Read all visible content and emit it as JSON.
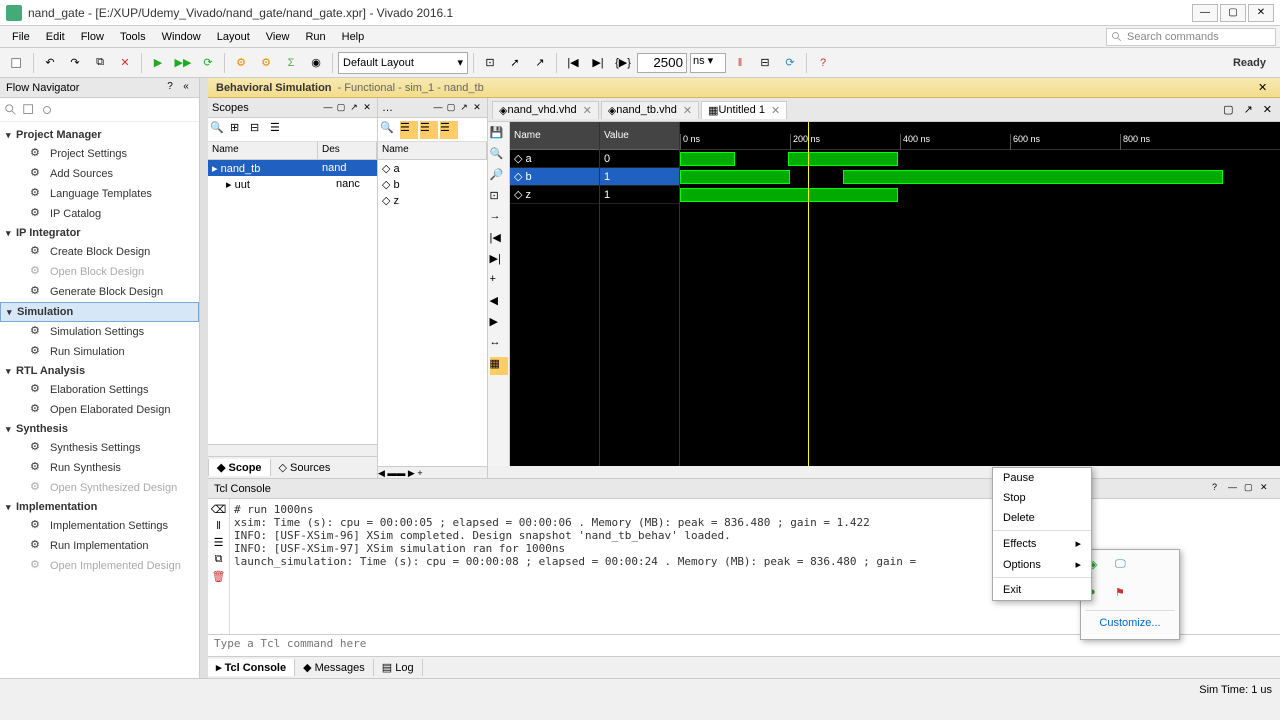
{
  "title": "nand_gate - [E:/XUP/Udemy_Vivado/nand_gate/nand_gate.xpr] - Vivado 2016.1",
  "menus": [
    "File",
    "Edit",
    "Flow",
    "Tools",
    "Window",
    "Layout",
    "View",
    "Run",
    "Help"
  ],
  "search_placeholder": "Search commands",
  "layout_combo": "Default Layout",
  "time_value": "2500",
  "time_unit": "ns",
  "ready": "Ready",
  "flownav": {
    "title": "Flow Navigator",
    "sections": [
      {
        "name": "Project Manager",
        "items": [
          "Project Settings",
          "Add Sources",
          "Language Templates",
          "IP Catalog"
        ]
      },
      {
        "name": "IP Integrator",
        "items": [
          "Create Block Design",
          "Open Block Design",
          "Generate Block Design"
        ]
      },
      {
        "name": "Simulation",
        "selected": true,
        "items": [
          "Simulation Settings",
          "Run Simulation"
        ]
      },
      {
        "name": "RTL Analysis",
        "items": [
          "Elaboration Settings",
          "Open Elaborated Design"
        ]
      },
      {
        "name": "Synthesis",
        "items": [
          "Synthesis Settings",
          "Run Synthesis",
          "Open Synthesized Design"
        ]
      },
      {
        "name": "Implementation",
        "items": [
          "Implementation Settings",
          "Run Implementation",
          "Open Implemented Design"
        ]
      }
    ]
  },
  "simheader": {
    "title": "Behavioral Simulation",
    "sub": "Functional",
    "run": "sim_1 - nand_tb"
  },
  "scopes": {
    "title": "Scopes",
    "cols": [
      "Name",
      "Des"
    ],
    "rows": [
      {
        "name": "nand_tb",
        "des": "nand",
        "selected": true
      },
      {
        "name": "uut",
        "des": "nanc",
        "indent": 1
      }
    ],
    "tabs": [
      "Scope",
      "Sources"
    ]
  },
  "objects": {
    "cols": [
      "Name"
    ],
    "rows": [
      {
        "name": "a"
      },
      {
        "name": "b"
      },
      {
        "name": "z"
      }
    ]
  },
  "wave": {
    "tabs": [
      {
        "label": "nand_vhd.vhd"
      },
      {
        "label": "nand_tb.vhd"
      },
      {
        "label": "Untitled 1",
        "active": true
      }
    ],
    "name_col": "Name",
    "value_col": "Value",
    "cursor": "235.501 ns",
    "ticks": [
      "0 ns",
      "200 ns",
      "400 ns",
      "600 ns",
      "800 ns"
    ],
    "signals": [
      {
        "name": "a",
        "value": "0"
      },
      {
        "name": "b",
        "value": "1",
        "selected": true
      },
      {
        "name": "z",
        "value": "1"
      }
    ]
  },
  "console": {
    "title": "Tcl Console",
    "lines": [
      "# run 1000ns",
      "xsim: Time (s): cpu = 00:00:05 ; elapsed = 00:00:06 . Memory (MB): peak = 836.480 ; gain = 1.422",
      "INFO: [USF-XSim-96] XSim completed. Design snapshot 'nand_tb_behav' loaded.",
      "INFO: [USF-XSim-97] XSim simulation ran for 1000ns",
      "launch_simulation: Time (s): cpu = 00:00:08 ; elapsed = 00:00:24 . Memory (MB): peak = 836.480 ; gain ="
    ],
    "placeholder": "Type a Tcl command here",
    "tabs": [
      "Tcl Console",
      "Messages",
      "Log"
    ]
  },
  "ctxmenu": [
    "Pause",
    "Stop",
    "Delete",
    "Effects",
    "Options",
    "Exit"
  ],
  "popup_customize": "Customize...",
  "status_simtime": "Sim Time: 1 us"
}
